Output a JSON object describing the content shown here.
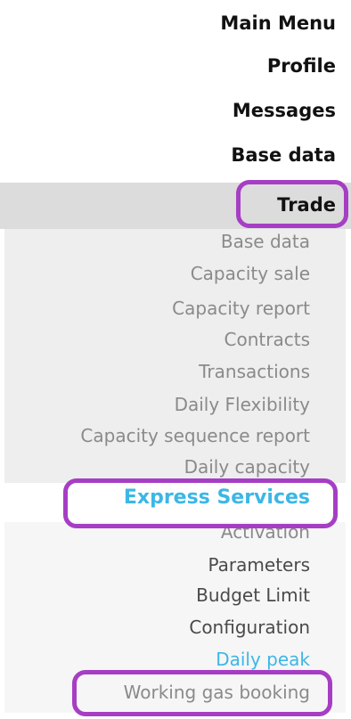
{
  "menu": {
    "main_menu": "Main Menu",
    "profile": "Profile",
    "messages": "Messages",
    "base_data": "Base data",
    "trade": {
      "label": "Trade",
      "items": {
        "base_data": "Base data",
        "capacity_sale": "Capacity sale",
        "capacity_report": "Capacity report",
        "contracts": "Contracts",
        "transactions": "Transactions",
        "daily_flexibility": "Daily Flexibility",
        "capacity_sequence_report": "Capacity sequence report",
        "daily_capacity": "Daily capacity",
        "express_services": {
          "label": "Express Services",
          "items": {
            "activation": "Activation",
            "parameters": "Parameters",
            "budget_limit": "Budget Limit",
            "configuration": "Configuration",
            "daily_peak": "Daily peak",
            "working_gas_booking": "Working gas booking"
          }
        }
      }
    }
  },
  "colors": {
    "highlight": "#a63ec4",
    "active_link": "#3cb7e6",
    "trade_band": "#dcdcdc",
    "submenu_bg": "#eeeeee",
    "muted_text": "#8a8a8a"
  }
}
